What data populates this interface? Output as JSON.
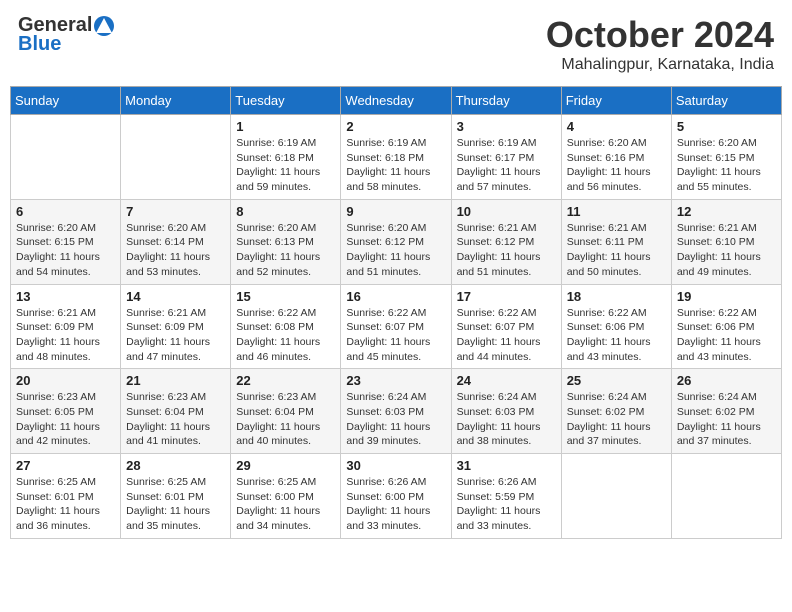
{
  "header": {
    "logo_general": "General",
    "logo_blue": "Blue",
    "month_title": "October 2024",
    "location": "Mahalingpur, Karnataka, India"
  },
  "days_of_week": [
    "Sunday",
    "Monday",
    "Tuesday",
    "Wednesday",
    "Thursday",
    "Friday",
    "Saturday"
  ],
  "weeks": [
    [
      {
        "day": "",
        "sunrise": "",
        "sunset": "",
        "daylight": ""
      },
      {
        "day": "",
        "sunrise": "",
        "sunset": "",
        "daylight": ""
      },
      {
        "day": "1",
        "sunrise": "Sunrise: 6:19 AM",
        "sunset": "Sunset: 6:18 PM",
        "daylight": "Daylight: 11 hours and 59 minutes."
      },
      {
        "day": "2",
        "sunrise": "Sunrise: 6:19 AM",
        "sunset": "Sunset: 6:18 PM",
        "daylight": "Daylight: 11 hours and 58 minutes."
      },
      {
        "day": "3",
        "sunrise": "Sunrise: 6:19 AM",
        "sunset": "Sunset: 6:17 PM",
        "daylight": "Daylight: 11 hours and 57 minutes."
      },
      {
        "day": "4",
        "sunrise": "Sunrise: 6:20 AM",
        "sunset": "Sunset: 6:16 PM",
        "daylight": "Daylight: 11 hours and 56 minutes."
      },
      {
        "day": "5",
        "sunrise": "Sunrise: 6:20 AM",
        "sunset": "Sunset: 6:15 PM",
        "daylight": "Daylight: 11 hours and 55 minutes."
      }
    ],
    [
      {
        "day": "6",
        "sunrise": "Sunrise: 6:20 AM",
        "sunset": "Sunset: 6:15 PM",
        "daylight": "Daylight: 11 hours and 54 minutes."
      },
      {
        "day": "7",
        "sunrise": "Sunrise: 6:20 AM",
        "sunset": "Sunset: 6:14 PM",
        "daylight": "Daylight: 11 hours and 53 minutes."
      },
      {
        "day": "8",
        "sunrise": "Sunrise: 6:20 AM",
        "sunset": "Sunset: 6:13 PM",
        "daylight": "Daylight: 11 hours and 52 minutes."
      },
      {
        "day": "9",
        "sunrise": "Sunrise: 6:20 AM",
        "sunset": "Sunset: 6:12 PM",
        "daylight": "Daylight: 11 hours and 51 minutes."
      },
      {
        "day": "10",
        "sunrise": "Sunrise: 6:21 AM",
        "sunset": "Sunset: 6:12 PM",
        "daylight": "Daylight: 11 hours and 51 minutes."
      },
      {
        "day": "11",
        "sunrise": "Sunrise: 6:21 AM",
        "sunset": "Sunset: 6:11 PM",
        "daylight": "Daylight: 11 hours and 50 minutes."
      },
      {
        "day": "12",
        "sunrise": "Sunrise: 6:21 AM",
        "sunset": "Sunset: 6:10 PM",
        "daylight": "Daylight: 11 hours and 49 minutes."
      }
    ],
    [
      {
        "day": "13",
        "sunrise": "Sunrise: 6:21 AM",
        "sunset": "Sunset: 6:09 PM",
        "daylight": "Daylight: 11 hours and 48 minutes."
      },
      {
        "day": "14",
        "sunrise": "Sunrise: 6:21 AM",
        "sunset": "Sunset: 6:09 PM",
        "daylight": "Daylight: 11 hours and 47 minutes."
      },
      {
        "day": "15",
        "sunrise": "Sunrise: 6:22 AM",
        "sunset": "Sunset: 6:08 PM",
        "daylight": "Daylight: 11 hours and 46 minutes."
      },
      {
        "day": "16",
        "sunrise": "Sunrise: 6:22 AM",
        "sunset": "Sunset: 6:07 PM",
        "daylight": "Daylight: 11 hours and 45 minutes."
      },
      {
        "day": "17",
        "sunrise": "Sunrise: 6:22 AM",
        "sunset": "Sunset: 6:07 PM",
        "daylight": "Daylight: 11 hours and 44 minutes."
      },
      {
        "day": "18",
        "sunrise": "Sunrise: 6:22 AM",
        "sunset": "Sunset: 6:06 PM",
        "daylight": "Daylight: 11 hours and 43 minutes."
      },
      {
        "day": "19",
        "sunrise": "Sunrise: 6:22 AM",
        "sunset": "Sunset: 6:06 PM",
        "daylight": "Daylight: 11 hours and 43 minutes."
      }
    ],
    [
      {
        "day": "20",
        "sunrise": "Sunrise: 6:23 AM",
        "sunset": "Sunset: 6:05 PM",
        "daylight": "Daylight: 11 hours and 42 minutes."
      },
      {
        "day": "21",
        "sunrise": "Sunrise: 6:23 AM",
        "sunset": "Sunset: 6:04 PM",
        "daylight": "Daylight: 11 hours and 41 minutes."
      },
      {
        "day": "22",
        "sunrise": "Sunrise: 6:23 AM",
        "sunset": "Sunset: 6:04 PM",
        "daylight": "Daylight: 11 hours and 40 minutes."
      },
      {
        "day": "23",
        "sunrise": "Sunrise: 6:24 AM",
        "sunset": "Sunset: 6:03 PM",
        "daylight": "Daylight: 11 hours and 39 minutes."
      },
      {
        "day": "24",
        "sunrise": "Sunrise: 6:24 AM",
        "sunset": "Sunset: 6:03 PM",
        "daylight": "Daylight: 11 hours and 38 minutes."
      },
      {
        "day": "25",
        "sunrise": "Sunrise: 6:24 AM",
        "sunset": "Sunset: 6:02 PM",
        "daylight": "Daylight: 11 hours and 37 minutes."
      },
      {
        "day": "26",
        "sunrise": "Sunrise: 6:24 AM",
        "sunset": "Sunset: 6:02 PM",
        "daylight": "Daylight: 11 hours and 37 minutes."
      }
    ],
    [
      {
        "day": "27",
        "sunrise": "Sunrise: 6:25 AM",
        "sunset": "Sunset: 6:01 PM",
        "daylight": "Daylight: 11 hours and 36 minutes."
      },
      {
        "day": "28",
        "sunrise": "Sunrise: 6:25 AM",
        "sunset": "Sunset: 6:01 PM",
        "daylight": "Daylight: 11 hours and 35 minutes."
      },
      {
        "day": "29",
        "sunrise": "Sunrise: 6:25 AM",
        "sunset": "Sunset: 6:00 PM",
        "daylight": "Daylight: 11 hours and 34 minutes."
      },
      {
        "day": "30",
        "sunrise": "Sunrise: 6:26 AM",
        "sunset": "Sunset: 6:00 PM",
        "daylight": "Daylight: 11 hours and 33 minutes."
      },
      {
        "day": "31",
        "sunrise": "Sunrise: 6:26 AM",
        "sunset": "Sunset: 5:59 PM",
        "daylight": "Daylight: 11 hours and 33 minutes."
      },
      {
        "day": "",
        "sunrise": "",
        "sunset": "",
        "daylight": ""
      },
      {
        "day": "",
        "sunrise": "",
        "sunset": "",
        "daylight": ""
      }
    ]
  ]
}
